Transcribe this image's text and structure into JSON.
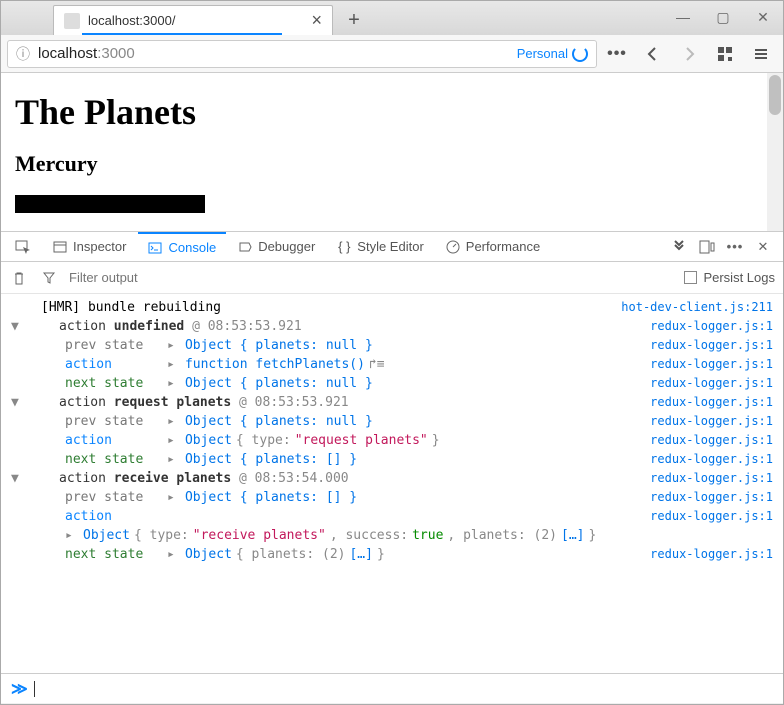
{
  "tab": {
    "title": "localhost:3000/"
  },
  "url": {
    "host": "localhost",
    "port": ":3000"
  },
  "personal_label": "Personal",
  "page": {
    "h1": "The Planets",
    "h2": "Mercury"
  },
  "devtools": {
    "tabs": {
      "inspector": "Inspector",
      "console": "Console",
      "debugger": "Debugger",
      "style": "Style Editor",
      "perf": "Performance"
    },
    "filter_placeholder": "Filter output",
    "persist_label": "Persist Logs"
  },
  "console_rows": [
    {
      "text_pre": "[HMR] bundle rebuilding",
      "src": "hot-dev-client.js:211"
    },
    {
      "group": "action",
      "name": "undefined",
      "ts": "@ 08:53:53.921",
      "src": "redux-logger.js:1"
    },
    {
      "label": "prev state",
      "obj": "Object { planets: null }",
      "src": "redux-logger.js:1"
    },
    {
      "label": "action",
      "func": "function fetchPlanets()",
      "src": "redux-logger.js:1"
    },
    {
      "label": "next state",
      "obj": "Object { planets: null }",
      "src": "redux-logger.js:1"
    },
    {
      "group": "action",
      "name": "request planets",
      "ts": "@ 08:53:53.921",
      "src": "redux-logger.js:1"
    },
    {
      "label": "prev state",
      "obj": "Object { planets: null }",
      "src": "redux-logger.js:1"
    },
    {
      "label": "action",
      "obj_type": "Object { type: \"request planets\" }",
      "src": "redux-logger.js:1"
    },
    {
      "label": "next state",
      "obj": "Object { planets: [] }",
      "src": "redux-logger.js:1"
    },
    {
      "group": "action",
      "name": "receive planets",
      "ts": "@ 08:53:54.000",
      "src": "redux-logger.js:1"
    },
    {
      "label": "prev state",
      "obj": "Object { planets: [] }",
      "src": "redux-logger.js:1"
    },
    {
      "label": "action",
      "obj_long": "Object { type: \"receive planets\", success: true, planets: (2) […] }",
      "src": "redux-logger.js:1"
    },
    {
      "label": "next state",
      "obj": "Object { planets: (2) […] }",
      "src": "redux-logger.js:1"
    }
  ]
}
